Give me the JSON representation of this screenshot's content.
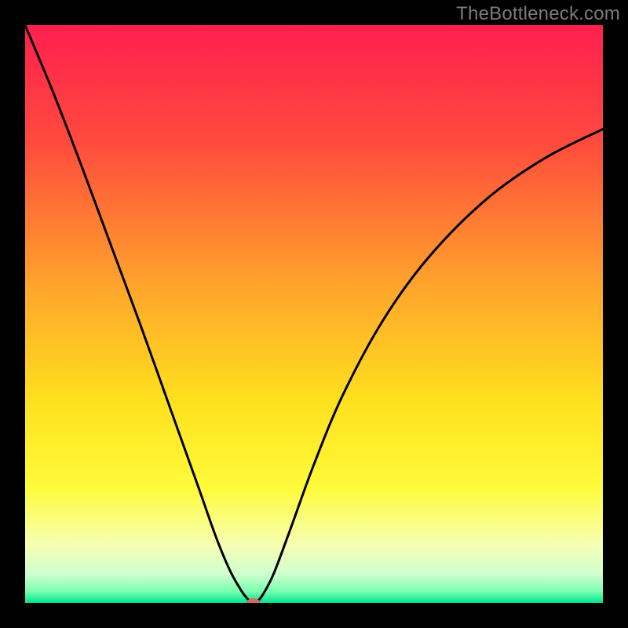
{
  "watermark": "TheBottleneck.com",
  "chart_data": {
    "type": "line",
    "title": "",
    "xlabel": "",
    "ylabel": "",
    "xlim": [
      0,
      1
    ],
    "ylim": [
      0,
      1
    ],
    "grid": false,
    "legend": false,
    "background_gradient": {
      "stops": [
        {
          "pos": 0.0,
          "color": "#ff1f4f"
        },
        {
          "pos": 0.2,
          "color": "#ff4a3d"
        },
        {
          "pos": 0.45,
          "color": "#ffa42c"
        },
        {
          "pos": 0.65,
          "color": "#ffe01e"
        },
        {
          "pos": 0.8,
          "color": "#fffb3a"
        },
        {
          "pos": 0.9,
          "color": "#f6ffb3"
        },
        {
          "pos": 0.95,
          "color": "#cfffcf"
        },
        {
          "pos": 0.98,
          "color": "#7affb0"
        },
        {
          "pos": 1.0,
          "color": "#00e38f"
        }
      ]
    },
    "series": [
      {
        "name": "curve",
        "stroke": "#000000",
        "stroke_width": 3,
        "x": [
          0.0,
          0.05,
          0.1,
          0.15,
          0.2,
          0.25,
          0.3,
          0.33,
          0.355,
          0.375,
          0.385,
          0.39,
          0.395,
          0.4,
          0.41,
          0.43,
          0.46,
          0.5,
          0.55,
          0.62,
          0.7,
          0.8,
          0.9,
          1.0
        ],
        "y": [
          1.0,
          0.88,
          0.75,
          0.615,
          0.48,
          0.34,
          0.2,
          0.115,
          0.055,
          0.02,
          0.007,
          0.002,
          0.0,
          0.002,
          0.012,
          0.05,
          0.13,
          0.24,
          0.36,
          0.49,
          0.6,
          0.7,
          0.77,
          0.82
        ]
      }
    ],
    "marker": {
      "cx": 0.395,
      "cy": 0.0,
      "rx": 0.012,
      "ry": 0.008,
      "fill": "#d46a5f"
    }
  }
}
